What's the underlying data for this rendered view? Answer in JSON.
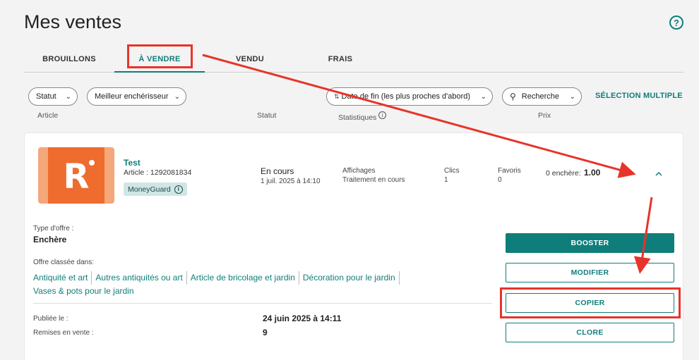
{
  "page": {
    "title": "Mes ventes",
    "help_icon": "?"
  },
  "tabs": [
    {
      "label": "BROUILLONS",
      "active": false
    },
    {
      "label": "À VENDRE",
      "active": true
    },
    {
      "label": "VENDU",
      "active": false
    },
    {
      "label": "FRAIS",
      "active": false
    }
  ],
  "filters": {
    "statut": "Statut",
    "meilleur": "Meilleur enchérisseur",
    "tri": "Date de fin (les plus proches d'abord)",
    "recherche": "Recherche",
    "selection_multiple": "SÉLECTION MULTIPLE"
  },
  "columns": {
    "article": "Article",
    "statut": "Statut",
    "statistiques": "Statistiques",
    "prix": "Prix"
  },
  "listing": {
    "thumbnail_letter": "R",
    "title": "Test",
    "article_number": "Article : 1292081834",
    "badge": "MoneyGuard",
    "status": "En cours",
    "status_date": "1 juil. 2025 à 14:10",
    "affichages_label": "Affichages",
    "affichages_value": "Traitement en cours",
    "clics_label": "Clics",
    "clics_value": "1",
    "favoris_label": "Favoris",
    "favoris_value": "0",
    "bids_label": "0 enchère:",
    "price": "1.00"
  },
  "details": {
    "type_offre_label": "Type d'offre :",
    "type_offre_value": "Enchère",
    "categories_label": "Offre classée dans:",
    "categories": [
      "Antiquité et art",
      "Autres antiquités ou art",
      "Article de bricolage et jardin",
      "Décoration pour le jardin",
      "Vases & pots pour le jardin"
    ],
    "publiee_label": "Publiée le :",
    "publiee_value": "24 juin 2025 à 14:11",
    "remises_label": "Remises en vente :",
    "remises_value": "9"
  },
  "actions": {
    "booster": "BOOSTER",
    "modifier": "MODIFIER",
    "copier": "COPIER",
    "clore": "CLORE"
  },
  "colors": {
    "accent": "#0f7e7a",
    "annotation": "#e8332a",
    "thumbnail_orange": "#ef6c2f"
  }
}
